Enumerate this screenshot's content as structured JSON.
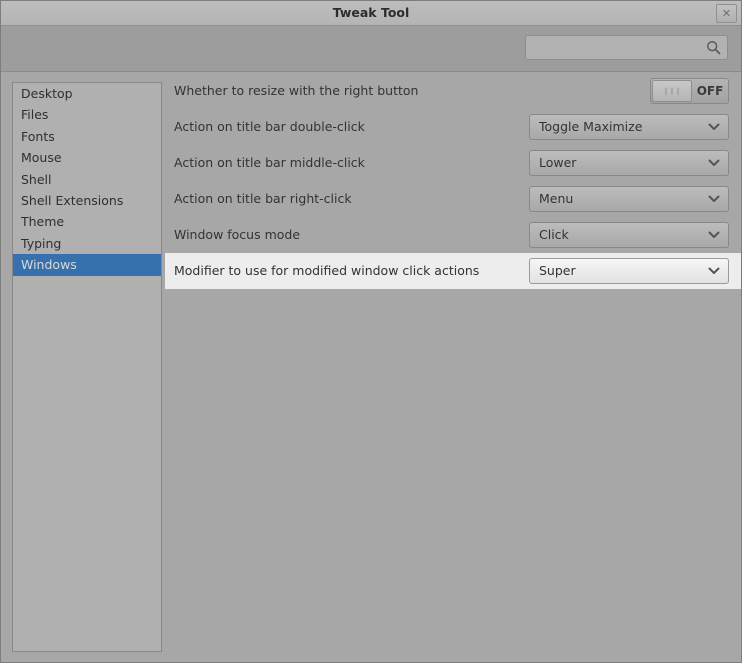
{
  "window": {
    "title": "Tweak Tool",
    "close_label": "✕",
    "close_icon": "close-icon"
  },
  "toolbar": {
    "search": {
      "value": "",
      "placeholder": "",
      "icon": "search-icon"
    }
  },
  "sidebar": {
    "items": [
      {
        "label": "Desktop",
        "selected": false
      },
      {
        "label": "Files",
        "selected": false
      },
      {
        "label": "Fonts",
        "selected": false
      },
      {
        "label": "Mouse",
        "selected": false
      },
      {
        "label": "Shell",
        "selected": false
      },
      {
        "label": "Shell Extensions",
        "selected": false
      },
      {
        "label": "Theme",
        "selected": false
      },
      {
        "label": "Typing",
        "selected": false
      },
      {
        "label": "Windows",
        "selected": true
      }
    ],
    "selected_label": "Windows"
  },
  "main": {
    "rows": [
      {
        "label": "Whether to resize with the right button",
        "control": "toggle",
        "value": "OFF",
        "highlighted": false
      },
      {
        "label": "Action on title bar double-click",
        "control": "combo",
        "value": "Toggle Maximize",
        "highlighted": false
      },
      {
        "label": "Action on title bar middle-click",
        "control": "combo",
        "value": "Lower",
        "highlighted": false
      },
      {
        "label": "Action on title bar right-click",
        "control": "combo",
        "value": "Menu",
        "highlighted": false
      },
      {
        "label": "Window focus mode",
        "control": "combo",
        "value": "Click",
        "highlighted": false
      },
      {
        "label": "Modifier to use for modified window click actions",
        "control": "combo",
        "value": "Super",
        "highlighted": true
      }
    ]
  },
  "colors": {
    "selection": "#3771ad",
    "window_bg": "#a7a7a7",
    "titlebar_bg": "#b8b8b8",
    "sidebar_bg": "#b0b0b0",
    "row_highlight": "#ededed"
  }
}
